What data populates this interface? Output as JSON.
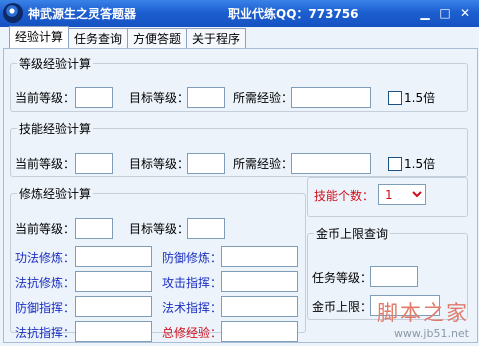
{
  "window": {
    "title": "神武源生之灵答题器",
    "contact": "职业代练QQ：773756"
  },
  "tabs": [
    {
      "label": "经验计算",
      "active": true
    },
    {
      "label": "任务查询",
      "active": false
    },
    {
      "label": "方便答题",
      "active": false
    },
    {
      "label": "关于程序",
      "active": false
    }
  ],
  "level_exp": {
    "title": "等级经验计算",
    "current_level_label": "当前等级：",
    "target_level_label": "目标等级：",
    "needed_exp_label": "所需经验：",
    "multiplier_label": "1.5倍",
    "current_level_value": "",
    "target_level_value": "",
    "needed_exp_value": ""
  },
  "skill_exp": {
    "title": "技能经验计算",
    "current_level_label": "当前等级：",
    "target_level_label": "目标等级：",
    "needed_exp_label": "所需经验：",
    "multiplier_label": "1.5倍",
    "current_level_value": "",
    "target_level_value": "",
    "needed_exp_value": ""
  },
  "cultivation": {
    "title": "修炼经验计算",
    "current_level_label": "当前等级：",
    "target_level_label": "目标等级：",
    "items": [
      {
        "label": "功法修炼：",
        "value": ""
      },
      {
        "label": "防御修炼：",
        "value": ""
      },
      {
        "label": "法抗修炼：",
        "value": ""
      },
      {
        "label": "攻击指挥：",
        "value": ""
      },
      {
        "label": "防御指挥：",
        "value": ""
      },
      {
        "label": "法术指挥：",
        "value": ""
      },
      {
        "label": "法抗指挥：",
        "value": ""
      },
      {
        "label": "总修经验：",
        "value": ""
      }
    ]
  },
  "skill_count": {
    "label": "技能个数：",
    "selected": "1"
  },
  "gold_cap": {
    "title": "金币上限查询",
    "task_level_label": "任务等级：",
    "gold_cap_label": "金币上限：",
    "task_level_value": "",
    "gold_cap_value": ""
  },
  "watermark": {
    "text": "脚本之家",
    "url": "www.jb51.net"
  }
}
